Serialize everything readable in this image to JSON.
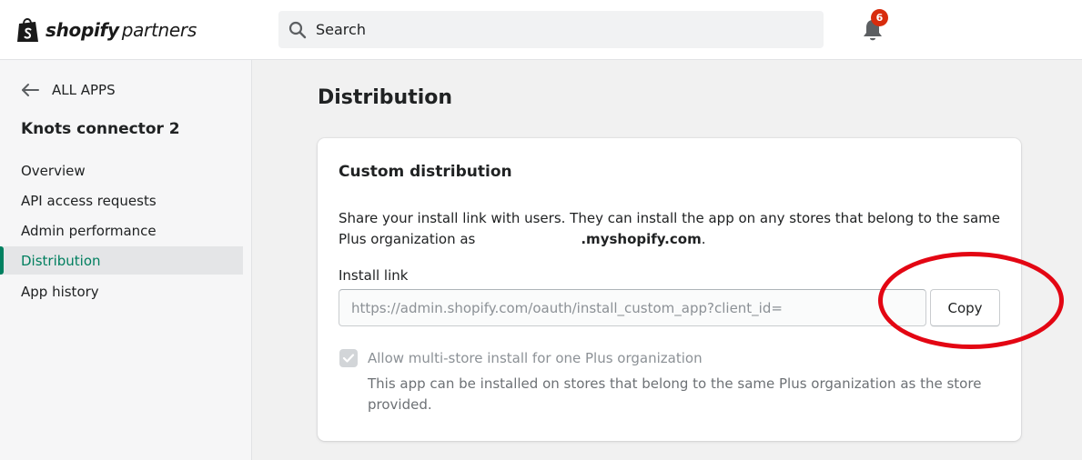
{
  "brand": {
    "bold": "shopify",
    "light": "partners"
  },
  "search": {
    "placeholder": "Search"
  },
  "notifications": {
    "count": "6"
  },
  "sidebar": {
    "back_label": "ALL APPS",
    "app_name": "Knots connector 2",
    "items": [
      {
        "label": "Overview",
        "active": false
      },
      {
        "label": "API access requests",
        "active": false
      },
      {
        "label": "Admin performance",
        "active": false
      },
      {
        "label": "Distribution",
        "active": true
      },
      {
        "label": "App history",
        "active": false
      }
    ]
  },
  "main": {
    "title": "Distribution",
    "card": {
      "title": "Custom distribution",
      "description_prefix": "Share your install link with users. They can install the app on any stores that belong to the same Plus organization as",
      "description_domain": ".myshopify.com",
      "description_suffix": ".",
      "install_link_label": "Install link",
      "install_link_value": "https://admin.shopify.com/oauth/install_custom_app?client_id=",
      "copy_button": "Copy",
      "checkbox_label": "Allow multi-store install for one Plus organization",
      "checkbox_checked": true,
      "checkbox_help": "This app can be installed on stores that belong to the same Plus organization as the store provided."
    }
  },
  "colors": {
    "accent_green": "#008060",
    "badge_red": "#d82c0d",
    "annotation_red": "#e30613"
  },
  "icons": {
    "logo": "shopify-bag-icon",
    "search": "search-icon",
    "bell": "bell-icon",
    "back": "arrow-left-icon",
    "check": "checkmark-icon"
  }
}
